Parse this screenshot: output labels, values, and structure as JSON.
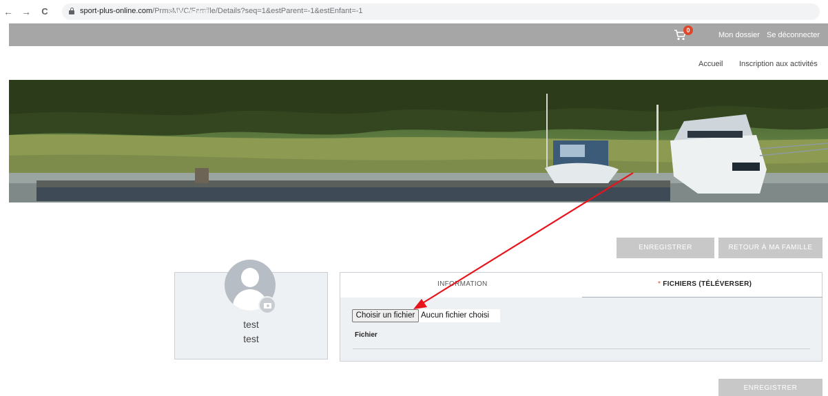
{
  "browser": {
    "url_host": "sport-plus-online.com",
    "url_path": "/PrmsMVC/Famille/Details?seq=1&estParent=-1&estEnfant=-1",
    "back_icon": "←",
    "forward_icon": "→",
    "reload_icon": "C"
  },
  "topbar": {
    "favorite_link": "Créer un favori",
    "cart_count": "0",
    "my_file": "Mon dossier",
    "logout": "Se déconnecter"
  },
  "subnav": {
    "home": "Accueil",
    "registration": "Inscription aux activités"
  },
  "actions": {
    "save_top": "ENREGISTRER",
    "back_family": "RETOUR À MA FAMILLE",
    "save_bottom": "ENREGISTRER"
  },
  "profile": {
    "first_name": "test",
    "last_name": "test"
  },
  "tabs": {
    "information": "INFORMATION",
    "files_marker": "*",
    "files": "FICHIERS (TÉLÉVERSER)"
  },
  "upload": {
    "button_label": "Choisir un fichier",
    "status": "Aucun fichier choisi",
    "field_label": "Fichier"
  },
  "colors": {
    "top_bar": "#a6a6a6",
    "button_bg": "#c8c8c8",
    "badge": "#e0462a",
    "annotation_arrow": "#e8141c"
  }
}
